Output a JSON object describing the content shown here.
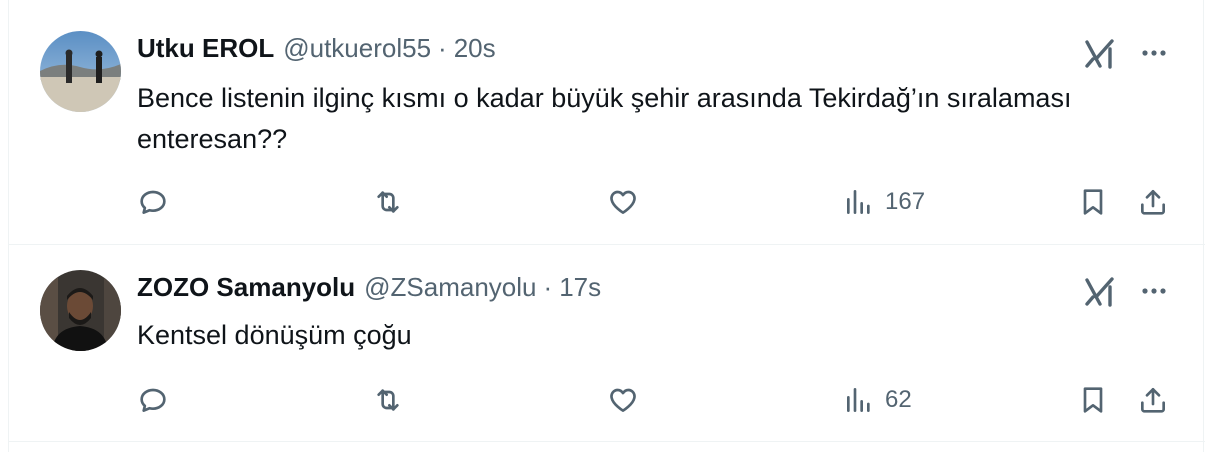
{
  "tweets": [
    {
      "name": "Utku EROL",
      "handle": "@utkuerol55",
      "separator": "·",
      "time": "20s",
      "text": "Bence listenin ilginç kısmı o kadar büyük şehir arasında Tekirdağ’ın sıralaması enteresan??",
      "views": "167",
      "icons": [
        "reply-icon",
        "retweet-icon",
        "like-icon",
        "views-icon",
        "bookmark-icon",
        "share-icon",
        "grok-icon",
        "more-icon"
      ]
    },
    {
      "name": "ZOZO Samanyolu",
      "handle": "@ZSamanyolu",
      "separator": "·",
      "time": "17s",
      "text": "Kentsel dönüşüm çoğu",
      "views": "62",
      "icons": [
        "reply-icon",
        "retweet-icon",
        "like-icon",
        "views-icon",
        "bookmark-icon",
        "share-icon",
        "grok-icon",
        "more-icon"
      ]
    }
  ],
  "colors": {
    "primary_text": "#0f1419",
    "secondary_text": "#536471",
    "divider": "#eff3f4",
    "background": "#ffffff"
  }
}
